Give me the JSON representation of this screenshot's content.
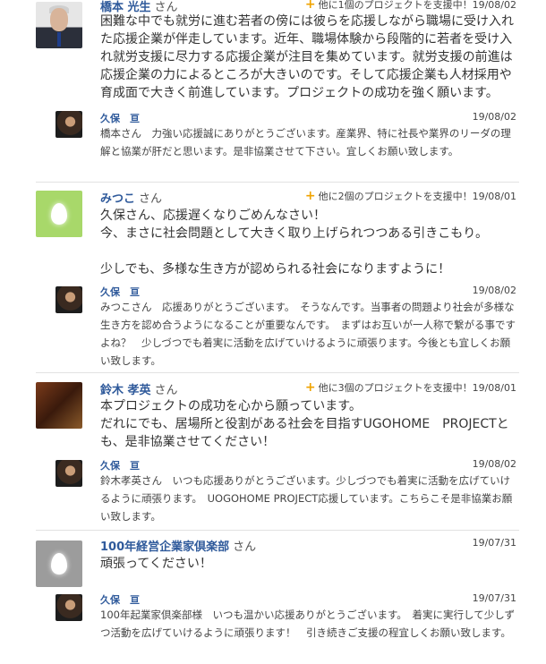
{
  "comments": [
    {
      "name": "橋本 光生",
      "suffix": "さん",
      "meta": "他に1個のプロジェクトを支援中！19/08/02",
      "body": "困難な中でも就労に進む若者の傍には彼らを応援しながら職場に受け入れた応援企業が伴走しています。近年、職場体験から段階的に若者を受け入れ就労支援に尽力する応援企業が注目を集めています。就労支援の前進は応援企業の力によるところが大きいのです。そして応援企業も人材採用や育成面で大きく前進しています。プロジェクトの成功を強く願います。",
      "reply": {
        "name": "久保　亘",
        "date": "19/08/02",
        "body": "橋本さん　力強い応援誠にありがとうございます。産業界、特に社長や業界のリーダの理解と協業が肝だと思います。是非協業させて下さい。宜しくお願い致します。"
      }
    },
    {
      "name": "みつこ",
      "suffix": "さん",
      "meta": "他に2個のプロジェクトを支援中！19/08/01",
      "body": "久保さん、応援遅くなりごめんなさい！\n今、まさに社会問題として大きく取り上げられつつある引きこもり。\n\n少しでも、多様な生き方が認められる社会になりますように！",
      "reply": {
        "name": "久保　亘",
        "date": "19/08/02",
        "body": "みつこさん　応援ありがとうございます。　そうなんです。当事者の問題より社会が多様な生き方を認め合うようになることが重要なんです。　まずはお互いが一人称で繋がる事ですよね？　少しづつでも着実に活動を広げていけるように頑張ります。今後とも宜しくお願い致します。"
      }
    },
    {
      "name": "鈴木 孝英",
      "suffix": "さん",
      "meta": "他に3個のプロジェクトを支援中！19/08/01",
      "body": "本プロジェクトの成功を心から願っています。\nだれにでも、居場所と役割がある社会を目指すUGOHOME　PROJECTとも、是非協業させてください！",
      "reply": {
        "name": "久保　亘",
        "date": "19/08/02",
        "body": "鈴木孝英さん　いつも応援ありがとうございます。少しづつでも着実に活動を広げていけるように頑張ります。　UOGOHOME PROJECT応援しています。こちらこそ是非協業お願い致します。"
      }
    },
    {
      "name": "100年経営企業家倶楽部",
      "suffix": "さん",
      "meta": "",
      "date_only": "19/07/31",
      "body": "頑張ってください！",
      "reply": {
        "name": "久保　亘",
        "date": "19/07/31",
        "body": "100年起業家倶楽部様　いつも温かい応援ありがとうございます。　着実に実行して少しずつ活動を広げていけるように頑張ります！　引き続きご支援の程宜しくお願い致します。"
      }
    }
  ],
  "colors": {
    "name": "#2f5a9b",
    "plus": "#f0a300",
    "divider": "#e2e2e2"
  },
  "icons": [
    "plus-icon",
    "avatar-man-suit",
    "avatar-egg-green",
    "avatar-photo",
    "avatar-egg-gray",
    "avatar-dark-photo"
  ]
}
